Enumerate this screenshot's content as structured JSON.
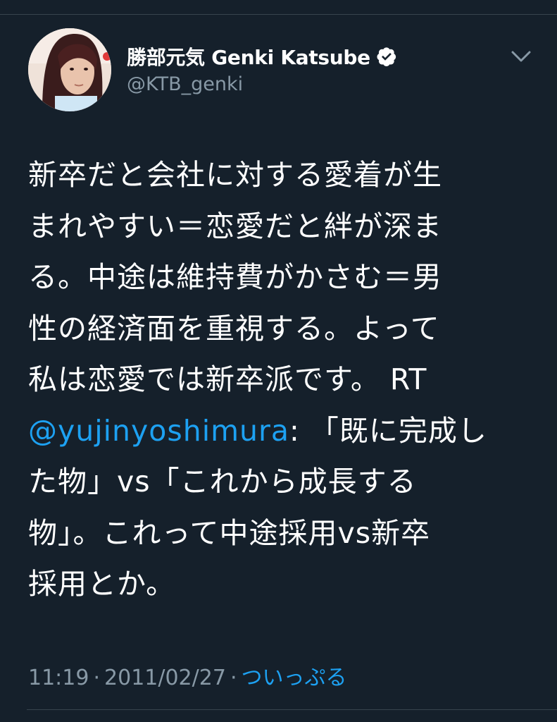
{
  "tweet": {
    "author": {
      "display_name": "勝部元気 Genki Katsube",
      "handle": "@KTB_genki",
      "verified": true,
      "avatar_icon": "profile-photo"
    },
    "menu_icon": "chevron-down-icon",
    "body_lines": [
      "新卒だと会社に対する愛着が生",
      "まれやすい＝恋愛だと絆が深ま",
      "る。中途は維持費がかさむ＝男",
      "性の経済面を重視する。よって",
      "私は恋愛では新卒派です。 RT"
    ],
    "mention": "@yujinyoshimura",
    "mention_suffix": ": 「既に完成し",
    "body_lines_after": [
      "た物」vs「これから成長する",
      "物」。これって中途採用vs新卒",
      "採用とか。"
    ],
    "time": "11:19",
    "separator": "·",
    "date": "2011/02/27",
    "source": "ついっぷる"
  },
  "colors": {
    "background": "#15202b",
    "text": "#ffffff",
    "secondary_text": "#8899a6",
    "link": "#1da1f2",
    "divider": "#38444d"
  }
}
